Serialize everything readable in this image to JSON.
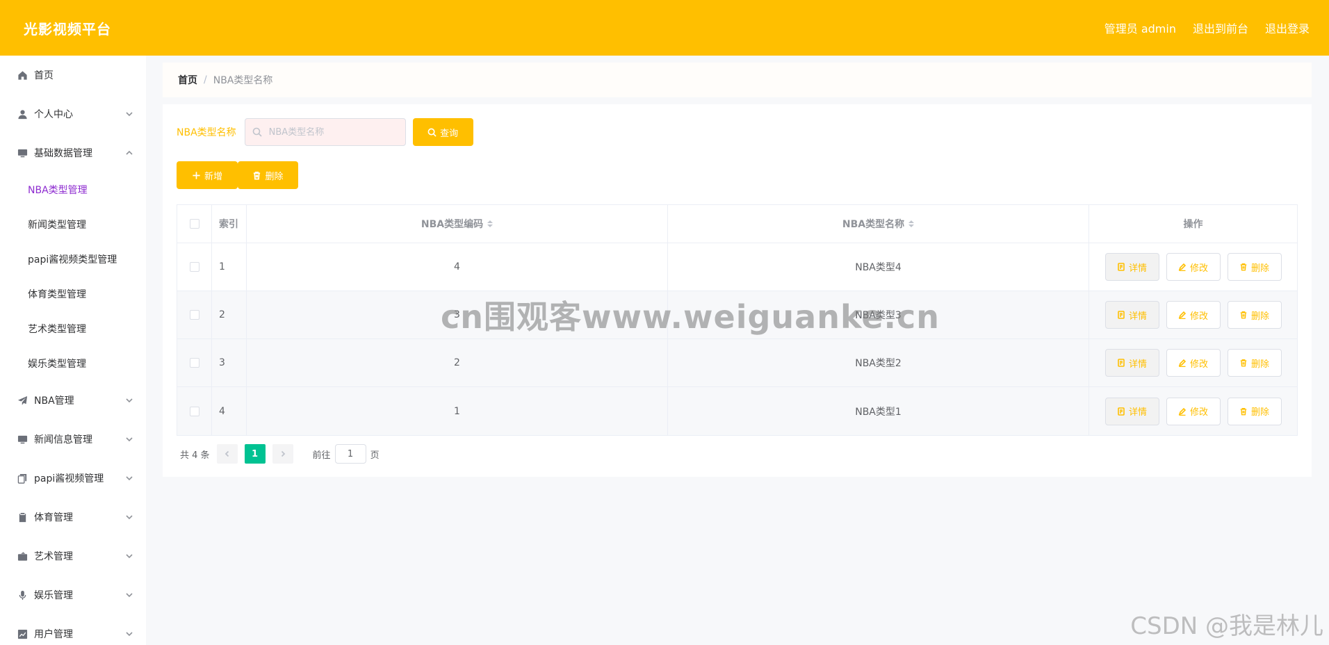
{
  "header": {
    "brand": "光影视频平台",
    "user": "管理员 admin",
    "to_front": "退出到前台",
    "logout": "退出登录"
  },
  "sidebar": {
    "items": [
      {
        "label": "首页",
        "icon": "home-icon",
        "expandable": false
      },
      {
        "label": "个人中心",
        "icon": "user-icon",
        "expandable": true
      },
      {
        "label": "基础数据管理",
        "icon": "monitor-icon",
        "expandable": true,
        "expanded": true
      },
      {
        "label": "NBA管理",
        "icon": "send-icon",
        "expandable": true
      },
      {
        "label": "新闻信息管理",
        "icon": "monitor-icon",
        "expandable": true
      },
      {
        "label": "papi酱视频管理",
        "icon": "copy-icon",
        "expandable": true
      },
      {
        "label": "体育管理",
        "icon": "clipboard-icon",
        "expandable": true
      },
      {
        "label": "艺术管理",
        "icon": "wallet-icon",
        "expandable": true
      },
      {
        "label": "娱乐管理",
        "icon": "microphone-icon",
        "expandable": true
      },
      {
        "label": "用户管理",
        "icon": "chart-icon",
        "expandable": true
      }
    ],
    "subitems": [
      {
        "label": "NBA类型管理",
        "active": true
      },
      {
        "label": "新闻类型管理"
      },
      {
        "label": "papi酱视频类型管理"
      },
      {
        "label": "体育类型管理"
      },
      {
        "label": "艺术类型管理"
      },
      {
        "label": "娱乐类型管理"
      }
    ]
  },
  "breadcrumb": {
    "home": "首页",
    "current": "NBA类型名称"
  },
  "search": {
    "label": "NBA类型名称",
    "placeholder": "NBA类型名称",
    "value": "",
    "button": "查询"
  },
  "actions": {
    "add": "新增",
    "delete": "删除"
  },
  "table": {
    "headers": {
      "index": "索引",
      "code": "NBA类型编码",
      "name": "NBA类型名称",
      "op": "操作"
    },
    "rows": [
      {
        "index": "1",
        "code": "4",
        "name": "NBA类型4"
      },
      {
        "index": "2",
        "code": "3",
        "name": "NBA类型3"
      },
      {
        "index": "3",
        "code": "2",
        "name": "NBA类型2"
      },
      {
        "index": "4",
        "code": "1",
        "name": "NBA类型1"
      }
    ],
    "op_buttons": {
      "detail": "详情",
      "edit": "修改",
      "delete": "删除"
    }
  },
  "pagination": {
    "total": "共 4 条",
    "current_page": "1",
    "goto_prefix": "前往",
    "goto_value": "1",
    "goto_suffix": "页"
  },
  "watermarks": {
    "center": "cn围观客www.weiguanke.cn",
    "corner": "CSDN @我是林儿"
  },
  "colors": {
    "accent": "#ffbf00",
    "active_menu": "#8e2cd0",
    "pager_active": "#00c292"
  }
}
